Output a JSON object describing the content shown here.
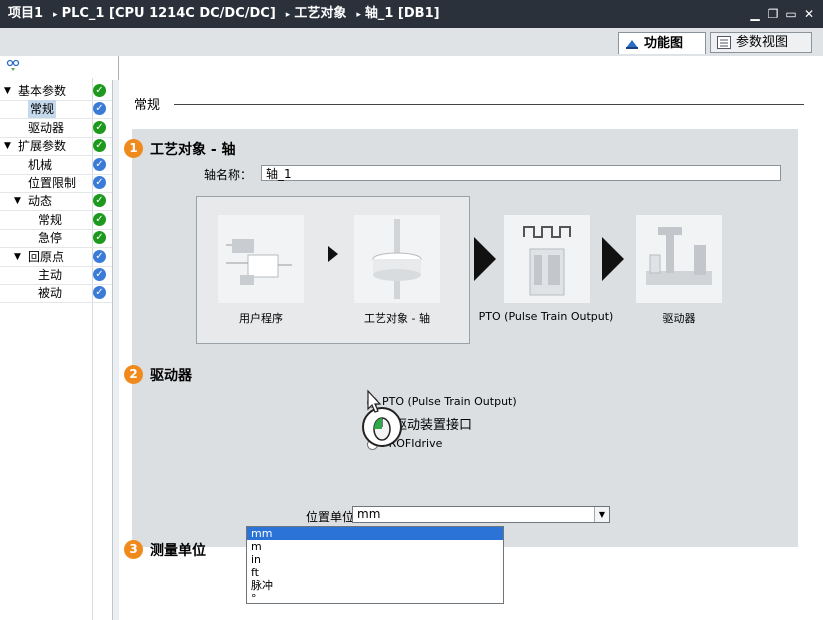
{
  "titlebar": {
    "crumbs": [
      "项目1",
      "PLC_1 [CPU 1214C DC/DC/DC]",
      "工艺对象",
      "轴_1 [DB1]"
    ],
    "sep": "▸",
    "ctrls": [
      "▁",
      "❐",
      "▭",
      "✕"
    ]
  },
  "tabs": {
    "function_view": "功能图",
    "param_view": "参数视图"
  },
  "tree": {
    "items": [
      {
        "label": "基本参数",
        "status": "ok",
        "level": 0,
        "expanded": true
      },
      {
        "label": "常规",
        "status": "blue",
        "level": 1,
        "selected": true
      },
      {
        "label": "驱动器",
        "status": "ok",
        "level": 1
      },
      {
        "label": "扩展参数",
        "status": "ok",
        "level": 0,
        "expanded": true
      },
      {
        "label": "机械",
        "status": "blue",
        "level": 1
      },
      {
        "label": "位置限制",
        "status": "blue",
        "level": 1
      },
      {
        "label": "动态",
        "status": "ok",
        "level": 1,
        "expanded": true
      },
      {
        "label": "常规",
        "status": "ok",
        "level": 2
      },
      {
        "label": "急停",
        "status": "ok",
        "level": 2
      },
      {
        "label": "回原点",
        "status": "blue",
        "level": 1,
        "expanded": true
      },
      {
        "label": "主动",
        "status": "blue",
        "level": 2
      },
      {
        "label": "被动",
        "status": "blue",
        "level": 2
      }
    ]
  },
  "content": {
    "section_title": "常规",
    "tech_object": {
      "badge": "1",
      "heading": "工艺对象 - 轴",
      "axis_name_label": "轴名称：",
      "axis_name_value": "轴_1"
    },
    "diagram": {
      "captions": [
        "用户程序",
        "工艺对象 - 轴",
        "PTO (Pulse Train Output)",
        "驱动器"
      ]
    },
    "drive": {
      "badge": "2",
      "heading": "驱动器",
      "options": [
        {
          "label": "PTO (Pulse Train Output)",
          "selected": true
        },
        {
          "label": "驱动装置接口",
          "selected": false
        },
        {
          "label": "PROFIdrive",
          "selected": false
        }
      ]
    },
    "units": {
      "badge": "3",
      "heading": "测量单位",
      "label": "位置单位：",
      "value": "mm",
      "options": [
        "mm",
        "m",
        "in",
        "ft",
        "脉冲",
        "°"
      ]
    }
  },
  "colors": {
    "titlebar": "#2a313b",
    "badge": "#f08a1c",
    "ok": "#1d9a1d",
    "blue": "#3b7bd8",
    "selection": "#2b73d6"
  }
}
